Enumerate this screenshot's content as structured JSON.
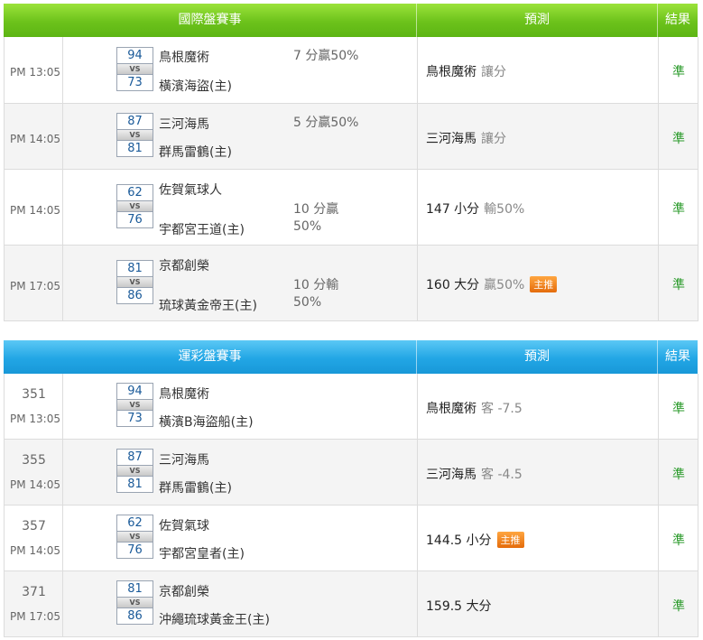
{
  "international": {
    "header": {
      "match": "國際盤賽事",
      "prediction": "預測",
      "result": "結果"
    },
    "rows": [
      {
        "time": "PM 13:05",
        "score1": "94",
        "vs": "VS",
        "score2": "73",
        "team1": "鳥根魔術",
        "team2": "橫濱海盜(主)",
        "handicap1": "7 分贏50%",
        "handicap2": "",
        "pred_main": "鳥根魔術",
        "pred_sub": "讓分",
        "badge": "",
        "result": "準"
      },
      {
        "time": "PM 14:05",
        "score1": "87",
        "vs": "VS",
        "score2": "81",
        "team1": "三河海馬",
        "team2": "群馬雷鶴(主)",
        "handicap1": "5 分贏50%",
        "handicap2": "",
        "pred_main": "三河海馬",
        "pred_sub": "讓分",
        "badge": "",
        "result": "準"
      },
      {
        "time": "PM 14:05",
        "score1": "62",
        "vs": "VS",
        "score2": "76",
        "team1": "佐賀氣球人",
        "team2": "宇都宮王道(主)",
        "handicap1": "10 分贏",
        "handicap2": "50%",
        "pred_main": "147 小分",
        "pred_sub": "輸50%",
        "badge": "",
        "result": "準"
      },
      {
        "time": "PM 17:05",
        "score1": "81",
        "vs": "VS",
        "score2": "86",
        "team1": "京都創榮",
        "team2": "琉球黃金帝王(主)",
        "handicap1": "10 分輸",
        "handicap2": "50%",
        "pred_main": "160 大分",
        "pred_sub": "贏50%",
        "badge": "主推",
        "result": "準"
      }
    ]
  },
  "sports_lottery": {
    "header": {
      "match": "運彩盤賽事",
      "prediction": "預測",
      "result": "結果"
    },
    "rows": [
      {
        "num": "351",
        "time": "PM 13:05",
        "score1": "94",
        "vs": "VS",
        "score2": "73",
        "team1": "鳥根魔術",
        "team2": "橫濱B海盜船(主)",
        "pred_main": "鳥根魔術",
        "pred_sub": "客 -7.5",
        "badge": "",
        "result": "準"
      },
      {
        "num": "355",
        "time": "PM 14:05",
        "score1": "87",
        "vs": "VS",
        "score2": "81",
        "team1": "三河海馬",
        "team2": "群馬雷鶴(主)",
        "pred_main": "三河海馬",
        "pred_sub": "客 -4.5",
        "badge": "",
        "result": "準"
      },
      {
        "num": "357",
        "time": "PM 14:05",
        "score1": "62",
        "vs": "VS",
        "score2": "76",
        "team1": "佐賀氣球",
        "team2": "宇都宮皇者(主)",
        "pred_main": "144.5 小分",
        "pred_sub": "",
        "badge": "主推",
        "result": "準"
      },
      {
        "num": "371",
        "time": "PM 17:05",
        "score1": "81",
        "vs": "VS",
        "score2": "86",
        "team1": "京都創榮",
        "team2": "沖繩琉球黃金王(主)",
        "pred_main": "159.5 大分",
        "pred_sub": "",
        "badge": "",
        "result": "準"
      }
    ]
  },
  "colors": {
    "green_header": "#6cc21b",
    "blue_header": "#22a6e5",
    "result_text": "#2a9a2a",
    "badge": "#f08a1c"
  }
}
